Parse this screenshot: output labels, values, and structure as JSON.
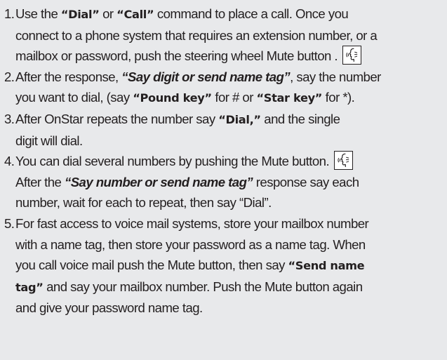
{
  "steps": [
    {
      "num": "1.",
      "lines": [
        [
          "Use the ",
          {
            "b": "“Dial”"
          },
          " or ",
          {
            "b": "“Call”"
          },
          " command to place a call. Once you"
        ],
        [
          "connect to a phone system that requires an extension number, or a"
        ],
        [
          "mailbox or password, push the  steering wheel Mute button . ",
          {
            "icon": "voice-mute-icon"
          }
        ]
      ]
    },
    {
      "num": "2.",
      "lines": [
        [
          "After the response, ",
          {
            "bi": "“Say digit or send name tag”"
          },
          ", say the number"
        ],
        [
          "you want to dial, (say ",
          {
            "b": "“Pound key”"
          },
          " for # or ",
          {
            "b": "“Star key”"
          },
          " for *)."
        ]
      ]
    },
    {
      "num": "3.",
      "lines": [
        [
          "After OnStar repeats the number say ",
          {
            "b": "“Dial,”"
          },
          " and the single"
        ],
        [
          "digit will dial."
        ]
      ]
    },
    {
      "num": "4.",
      "lines": [
        [
          "You can dial several numbers by pushing the Mute button. ",
          {
            "icon": "voice-mute-icon"
          }
        ],
        [
          "After the ",
          {
            "bi": "“Say number or send name tag”"
          },
          " response say each"
        ],
        [
          "number, wait for each to repeat, then say “Dial”."
        ]
      ]
    },
    {
      "num": "5.",
      "lines": [
        [
          "For fast access to voice mail systems, store your mailbox number"
        ],
        [
          "with a name tag, then store your password as a name tag. When"
        ],
        [
          "you call voice mail push the Mute button, then say ",
          {
            "b": "“Send name"
          }
        ],
        [
          {
            "b": "tag”"
          },
          " and say your mailbox number. Push the Mute button again"
        ],
        [
          "and give your password name tag."
        ]
      ]
    }
  ]
}
